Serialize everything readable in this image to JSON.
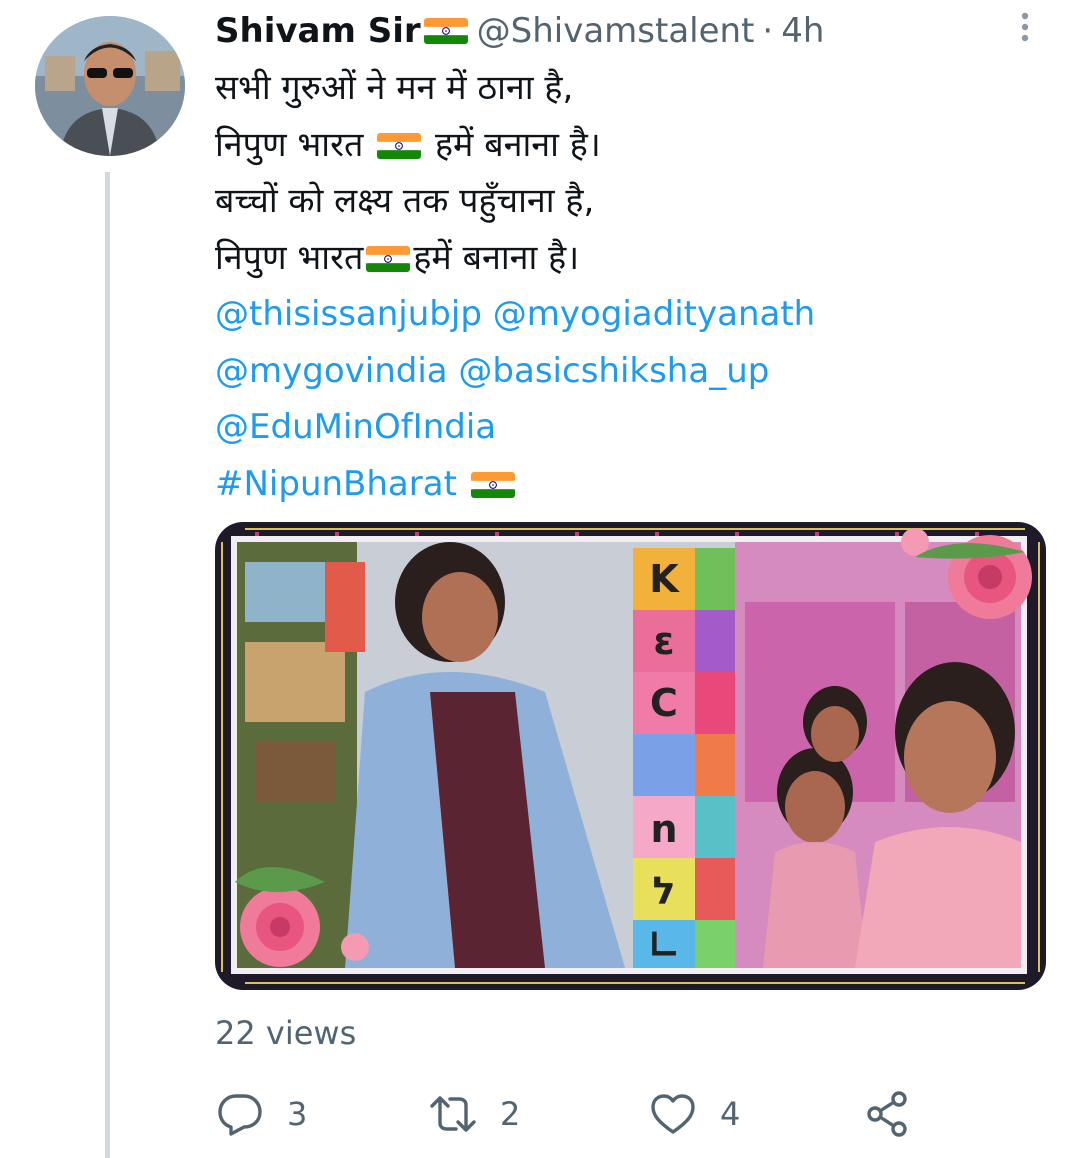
{
  "tweet": {
    "author_name": "Shivam Sir",
    "handle": "@Shivamstalent",
    "separator": "·",
    "time": "4h",
    "lines": [
      "सभी गुरुओं ने मन में ठाना है,",
      "निपुण भारत",
      "हमें बनाना है।",
      "बच्चों को लक्ष्य तक पहुँचाना है,",
      "निपुण भारत",
      "हमें बनाना है।"
    ],
    "mentions": [
      "@thisissanjubjp",
      "@myogiadityanath",
      "@mygovindia",
      "@basicshiksha_up",
      "@EduMinOfIndia"
    ],
    "hashtag": "#NipunBharat",
    "views": "22 views"
  },
  "actions": {
    "reply_count": "3",
    "retweet_count": "2",
    "like_count": "4"
  },
  "media": {
    "tiles": [
      "K",
      "ε",
      "C",
      "n",
      "ל",
      "∟"
    ]
  },
  "colors": {
    "link": "#1d9bf0",
    "secondary_text": "#536471",
    "thread_line": "#cfd9de",
    "flag_saffron": "#ff9933",
    "flag_green": "#138808",
    "flag_chakra": "#000080"
  },
  "icons": [
    "more-vertical-icon",
    "india-flag-icon",
    "reply-icon",
    "retweet-icon",
    "like-icon",
    "share-icon"
  ]
}
